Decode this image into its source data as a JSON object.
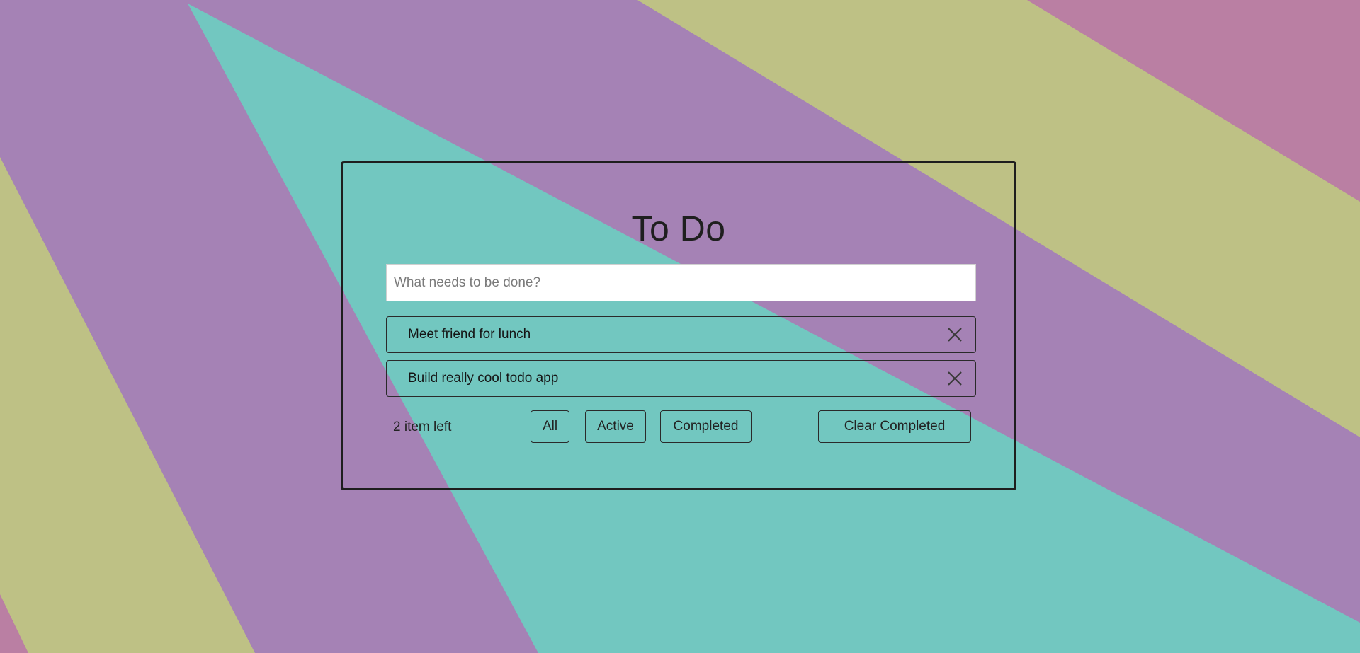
{
  "app": {
    "title": "To Do"
  },
  "new_todo": {
    "placeholder": "What needs to be done?",
    "value": ""
  },
  "todos": [
    {
      "label": "Meet friend for lunch",
      "icon": "close-icon"
    },
    {
      "label": "Build really cool todo app",
      "icon": "close-icon"
    }
  ],
  "footer": {
    "count_text": "2 item left",
    "filters": {
      "all": "All",
      "active": "Active",
      "completed": "Completed"
    },
    "clear_label": "Clear Completed"
  },
  "colors": {
    "purple": "#a582b5",
    "teal": "#72c7c0",
    "olive": "#bec185",
    "pink": "#ba7fa3",
    "border": "#1e1e1e"
  }
}
